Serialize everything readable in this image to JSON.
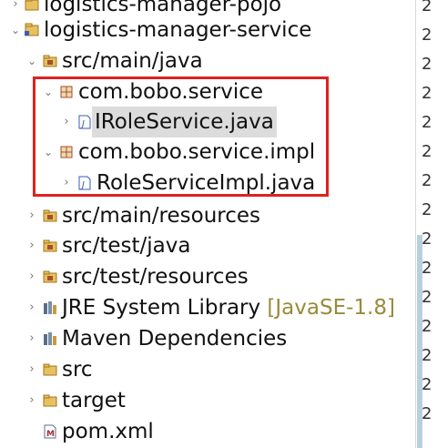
{
  "tree": {
    "items": [
      {
        "label": "logistics-manager-pojo",
        "icon": "project-icon",
        "arrow": "collapsed",
        "depth": 0
      },
      {
        "label": "logistics-manager-service",
        "icon": "project-icon",
        "arrow": "expanded",
        "depth": 0
      },
      {
        "label": "src/main/java",
        "icon": "source-folder-icon",
        "arrow": "expanded",
        "depth": 1
      },
      {
        "label": "com.bobo.service",
        "icon": "package-icon",
        "arrow": "expanded",
        "depth": 2
      },
      {
        "label": "IRoleService.java",
        "icon": "java-file-icon",
        "arrow": "collapsed",
        "depth": 3,
        "selected": true
      },
      {
        "label": "com.bobo.service.impl",
        "icon": "package-icon",
        "arrow": "expanded",
        "depth": 2
      },
      {
        "label": "RoleServiceImpl.java",
        "icon": "java-file-icon",
        "arrow": "collapsed",
        "depth": 3
      },
      {
        "label": "src/main/resources",
        "icon": "source-folder-icon",
        "arrow": "collapsed",
        "depth": 1
      },
      {
        "label": "src/test/java",
        "icon": "source-folder-icon",
        "arrow": "collapsed",
        "depth": 1
      },
      {
        "label": "src/test/resources",
        "icon": "source-folder-icon",
        "arrow": "collapsed",
        "depth": 1
      },
      {
        "label": "JRE System Library",
        "decoration": "[JavaSE-1.8]",
        "icon": "library-icon",
        "arrow": "collapsed",
        "depth": 1
      },
      {
        "label": "Maven Dependencies",
        "icon": "library-icon",
        "arrow": "collapsed",
        "depth": 1
      },
      {
        "label": "src",
        "icon": "folder-icon",
        "arrow": "collapsed",
        "depth": 1
      },
      {
        "label": "target",
        "icon": "folder-icon",
        "arrow": "collapsed",
        "depth": 1
      },
      {
        "label": "pom.xml",
        "icon": "maven-file-icon",
        "arrow": "none",
        "depth": 1
      }
    ]
  },
  "right_strip": {
    "numbers": [
      "2",
      "2",
      "2",
      "2",
      "2",
      "2",
      "2",
      "2",
      "2",
      "2",
      "2",
      "2",
      "2",
      "2",
      "2"
    ]
  },
  "colors": {
    "highlight_box": "#e02020",
    "selection": "#dcdcdc",
    "decoration": "#9a8a3a",
    "package_icon": "#a0522d",
    "folder_icon": "#e8c060",
    "java_file_icon": "#3b5bb5",
    "library_icon": "#5a6e8c"
  }
}
